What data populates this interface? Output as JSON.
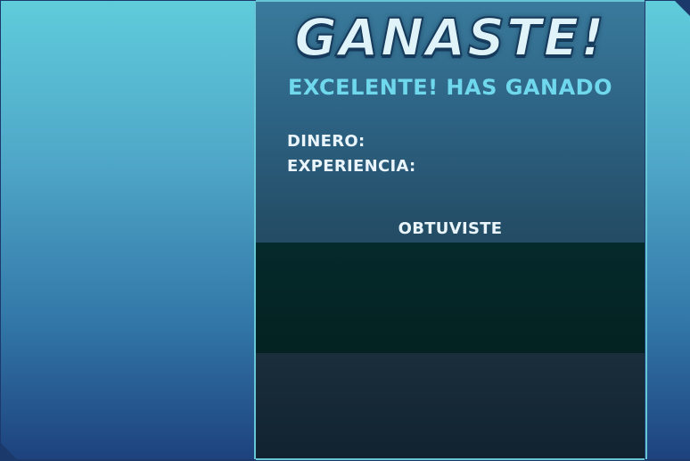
{
  "results": {
    "title": "GANASTE!",
    "subtitle": "EXCELENTE! HAS GANADO",
    "money_label": "DINERO:",
    "xp_label": "EXPERIENCIA:",
    "obtained_label": "OBTUVISTE"
  },
  "colors": {
    "accent_cyan": "#6fd8ec",
    "frame_border": "#67c6d6",
    "items_bg": "#032221"
  }
}
